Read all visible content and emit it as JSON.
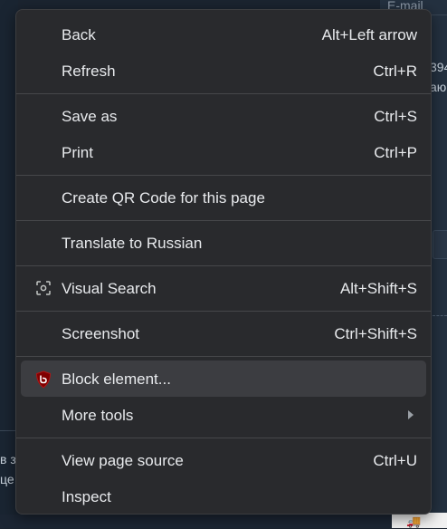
{
  "background": {
    "email_placeholder": "E-mail",
    "right_fragments": [
      "394",
      "аю"
    ],
    "left_fragments": [
      "в з",
      "це"
    ]
  },
  "menu": {
    "groups": [
      [
        {
          "label": "Back",
          "shortcut": "Alt+Left arrow"
        },
        {
          "label": "Refresh",
          "shortcut": "Ctrl+R"
        }
      ],
      [
        {
          "label": "Save as",
          "shortcut": "Ctrl+S"
        },
        {
          "label": "Print",
          "shortcut": "Ctrl+P"
        }
      ],
      [
        {
          "label": "Create QR Code for this page",
          "shortcut": ""
        }
      ],
      [
        {
          "label": "Translate to Russian",
          "shortcut": ""
        }
      ],
      [
        {
          "label": "Visual Search",
          "shortcut": "Alt+Shift+S",
          "icon": "visual-search-icon"
        }
      ],
      [
        {
          "label": "Screenshot",
          "shortcut": "Ctrl+Shift+S"
        }
      ],
      [
        {
          "label": "Block element...",
          "shortcut": "",
          "icon": "ublock-shield-icon",
          "hovered": true
        },
        {
          "label": "More tools",
          "shortcut": "",
          "submenu": true
        }
      ],
      [
        {
          "label": "View page source",
          "shortcut": "Ctrl+U"
        },
        {
          "label": "Inspect",
          "shortcut": ""
        }
      ]
    ]
  },
  "colors": {
    "menu_bg": "#292a2d",
    "hover_bg": "#3c3d41",
    "text": "#e8eaed",
    "ublock_red": "#800000"
  }
}
